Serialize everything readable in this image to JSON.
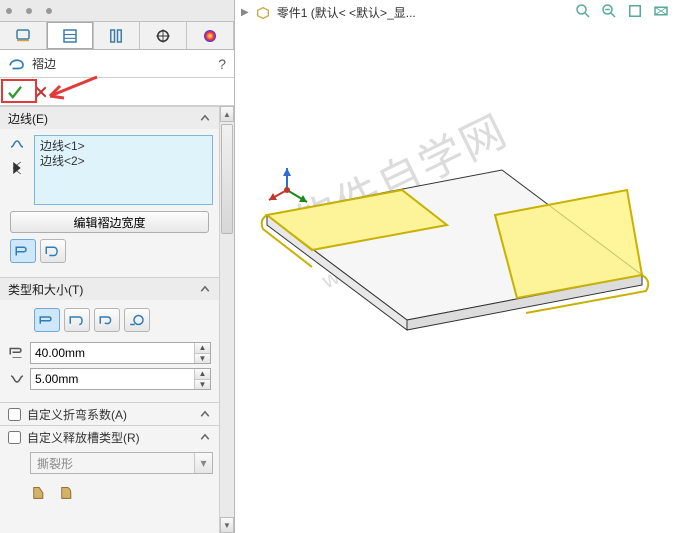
{
  "crumb": {
    "part": "零件1  (默认< <默认>_显..."
  },
  "feature": {
    "title": "褶边"
  },
  "edges": {
    "header": "边线(E)",
    "items": [
      "边线<1>",
      "边线<2>"
    ],
    "edit_width_btn": "编辑褶边宽度"
  },
  "type_size": {
    "header": "类型和大小(T)",
    "length_value": "40.00mm",
    "gap_value": "5.00mm"
  },
  "bend_allow": {
    "header": "自定义折弯系数(A)"
  },
  "relief": {
    "header": "自定义释放槽类型(R)",
    "combo_value": "撕裂形"
  }
}
